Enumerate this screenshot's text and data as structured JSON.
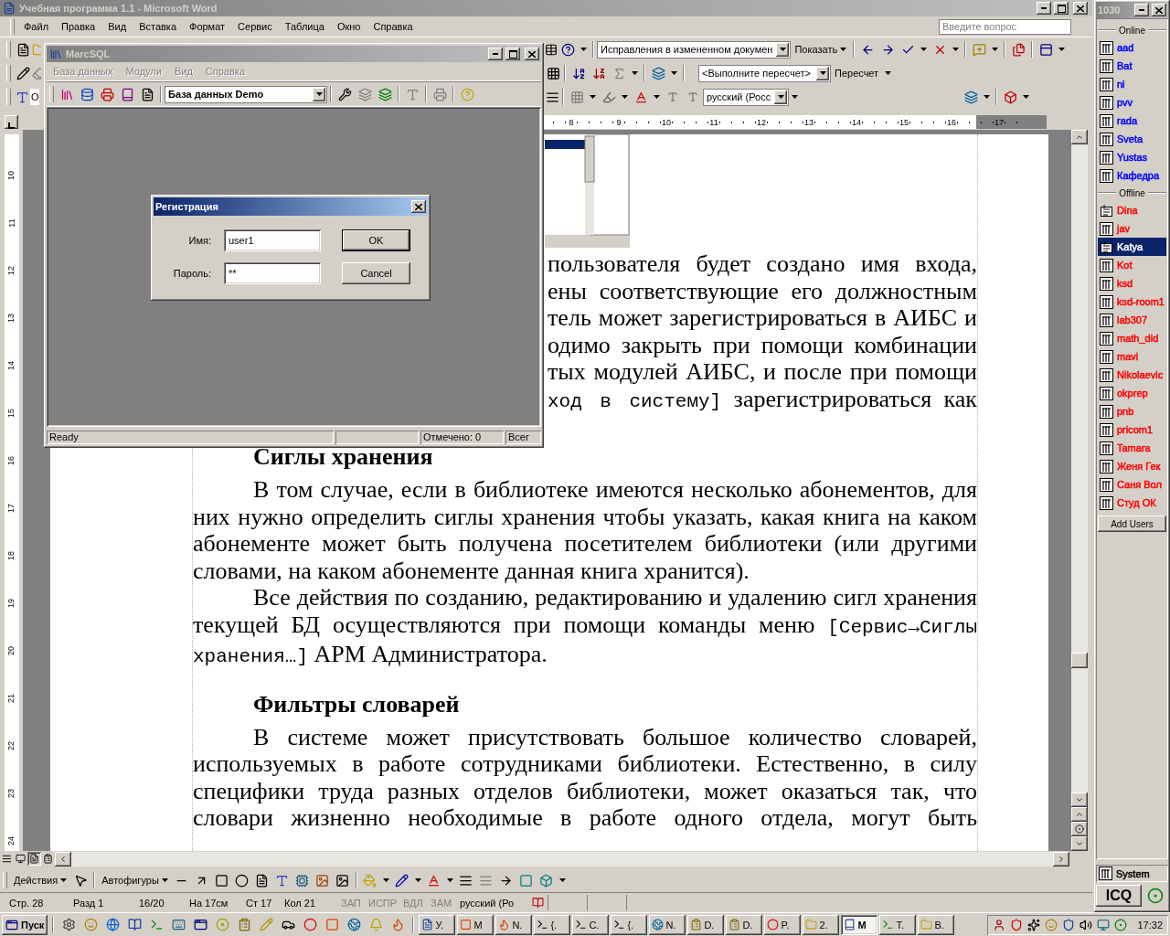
{
  "word": {
    "title": "Учебная программа 1.1 - Microsoft Word",
    "menu": [
      "Файл",
      "Правка",
      "Вид",
      "Вставка",
      "Формат",
      "Сервис",
      "Таблица",
      "Окно",
      "Справка"
    ],
    "question_box": {
      "placeholder": "Введите вопрос"
    },
    "toolbar": {
      "style_box": "О",
      "reviewing_combo": "Исправления в измененном докумен",
      "show_button": "Показать",
      "formula_combo": "<Выполните пересчет>",
      "recalc_button": "Пересчет",
      "language_combo": "русский (Росс"
    },
    "ruler": [
      "8",
      "9",
      "10",
      "11",
      "12",
      "13",
      "14",
      "15",
      "16",
      "17"
    ],
    "vertical_ruler": [
      "10",
      "11",
      "12",
      "13",
      "14",
      "15",
      "16",
      "17",
      "18",
      "19",
      "20",
      "21",
      "22",
      "23",
      "24"
    ],
    "document": {
      "partial_lines": [
        [
          {
            "kind": "text",
            "text": "пользователя будет создано имя входа,"
          }
        ],
        [
          {
            "kind": "text",
            "text": "ены соответствующие его должностным"
          }
        ],
        [
          {
            "kind": "text",
            "text": "тель может зарегистрироваться в АИБС и"
          }
        ],
        [
          {
            "kind": "text",
            "text": "одимо закрыть при помощи комбинации"
          }
        ],
        [
          {
            "kind": "text",
            "text": "тых модулей АИБС, и после при помощи"
          }
        ],
        [
          {
            "kind": "code",
            "text": "ход в систему]"
          },
          {
            "kind": "text",
            "text": " зарегистрироваться как"
          }
        ]
      ],
      "blocks": [
        {
          "kind": "heading",
          "parts": [
            {
              "kind": "text",
              "text": "Сиглы хранения"
            }
          ]
        },
        {
          "kind": "paragraph",
          "parts": [
            {
              "kind": "text",
              "text": "В том случае, если в библиотеке имеются несколько абонементов, для них нужно определить сиглы хранения чтобы указать, какая книга на каком абонементе может быть получена посетителем библиотеки (или другими словами, на каком абонементе данная книга хранится)."
            }
          ]
        },
        {
          "kind": "paragraph",
          "parts": [
            {
              "kind": "text",
              "text": "Все действия по созданию, редактированию и удалению сигл хранения текущей БД осуществляются при помощи команды меню "
            },
            {
              "kind": "code",
              "text": "[Сервис→Сиглы хранения…]"
            },
            {
              "kind": "text",
              "text": " АРМ Администратора."
            }
          ]
        },
        {
          "kind": "heading",
          "parts": [
            {
              "kind": "text",
              "text": "Фильтры словарей"
            }
          ]
        },
        {
          "kind": "paragraph",
          "parts": [
            {
              "kind": "text",
              "text": "В системе может присутствовать большое количество словарей, используемых в работе сотрудниками библиотеки. Естественно, в силу специфики труда разных отделов библиотеки, может оказаться так, что словари жизненно необходимые в работе одного отдела, могут быть"
            }
          ]
        }
      ]
    },
    "drawing_toolbar": {
      "actions": "Действия",
      "autoshapes": "Автофигуры"
    },
    "status_bar": {
      "fields": [
        "Стр. 28",
        "Разд 1",
        "16/20",
        "На 17см",
        "Ст 17",
        "Кол 21"
      ],
      "modes": [
        {
          "label": "ЗАП",
          "on": false
        },
        {
          "label": "ИСПР",
          "on": false
        },
        {
          "label": "ВДЛ",
          "on": false
        },
        {
          "label": "ЗАМ",
          "on": false
        }
      ],
      "language": "русский (Ро"
    }
  },
  "marcsql": {
    "title": "MarcSQL",
    "menu": [
      {
        "label": "База данных",
        "disabled": true
      },
      {
        "label": "Модули",
        "disabled": true
      },
      {
        "label": "Вид",
        "disabled": true
      },
      {
        "label": "Справка",
        "disabled": true
      }
    ],
    "database_combo": "База данных Demo",
    "status": {
      "message": "Ready",
      "marked": "Отмечено: 0",
      "total": "Всег"
    }
  },
  "dialog": {
    "title": "Регистрация",
    "fields": [
      {
        "label": "Имя:",
        "value": "user1"
      },
      {
        "label": "Пароль:",
        "value": "**"
      }
    ],
    "buttons": [
      {
        "label": "OK",
        "default": true
      },
      {
        "label": "Cancel",
        "default": false
      }
    ]
  },
  "icq": {
    "title": "1030",
    "groups": [
      {
        "label": "Online",
        "contacts": [
          {
            "name": "aad",
            "kind": "contact",
            "selected": false,
            "color": "#0000ff"
          },
          {
            "name": "Bat",
            "kind": "contact",
            "selected": false,
            "color": "#0000ff"
          },
          {
            "name": "ni",
            "kind": "contact",
            "selected": false,
            "color": "#0000ff"
          },
          {
            "name": "pvv",
            "kind": "contact",
            "selected": false,
            "color": "#0000ff"
          },
          {
            "name": "rada",
            "kind": "contact",
            "selected": false,
            "color": "#0000ff"
          },
          {
            "name": "Sveta",
            "kind": "contact",
            "selected": false,
            "color": "#0000ff"
          },
          {
            "name": "Yustas",
            "kind": "contact",
            "selected": false,
            "color": "#0000ff"
          },
          {
            "name": "Кафедра",
            "kind": "contact",
            "selected": false,
            "color": "#0000ff"
          }
        ]
      },
      {
        "label": "Offline",
        "contacts": [
          {
            "name": "Dina",
            "kind": "message",
            "selected": false,
            "color": "#ff0000"
          },
          {
            "name": "jav",
            "kind": "contact",
            "selected": false,
            "color": "#ff0000"
          },
          {
            "name": "Katya",
            "kind": "message",
            "selected": true
          },
          {
            "name": "Kot",
            "kind": "contact",
            "selected": false,
            "color": "#ff0000"
          },
          {
            "name": "ksd",
            "kind": "contact",
            "selected": false,
            "color": "#ff0000"
          },
          {
            "name": "ksd-room1",
            "kind": "contact",
            "selected": false,
            "color": "#ff0000"
          },
          {
            "name": "lab307",
            "kind": "contact",
            "selected": false,
            "color": "#ff0000"
          },
          {
            "name": "math_did",
            "kind": "contact",
            "selected": false,
            "color": "#ff0000"
          },
          {
            "name": "mavi",
            "kind": "contact",
            "selected": false,
            "color": "#ff0000"
          },
          {
            "name": "Nikolaevic",
            "kind": "contact",
            "selected": false,
            "color": "#ff0000"
          },
          {
            "name": "okprep",
            "kind": "contact",
            "selected": false,
            "color": "#ff0000"
          },
          {
            "name": "pnb",
            "kind": "contact",
            "selected": false,
            "color": "#ff0000"
          },
          {
            "name": "pricom1",
            "kind": "contact",
            "selected": false,
            "color": "#ff0000"
          },
          {
            "name": "Tamara",
            "kind": "contact",
            "selected": false,
            "color": "#ff0000"
          },
          {
            "name": "Женя Гек",
            "kind": "contact",
            "selected": false,
            "color": "#ff0000"
          },
          {
            "name": "Саня Вол",
            "kind": "contact",
            "selected": false,
            "color": "#ff0000"
          },
          {
            "name": "Студ ОК",
            "kind": "contact",
            "selected": false,
            "color": "#ff0000"
          }
        ]
      }
    ],
    "add_button": "Add Users",
    "system": "System",
    "logo": "ICQ"
  },
  "taskbar": {
    "start": "Пуск",
    "tasks": [
      {
        "label": "У.",
        "selected": false
      },
      {
        "label": "M",
        "selected": false
      },
      {
        "label": "N.",
        "selected": false
      },
      {
        "label": "{.",
        "selected": false
      },
      {
        "label": "C.",
        "selected": false
      },
      {
        "label": "{.",
        "selected": false
      },
      {
        "label": "N.",
        "selected": false
      },
      {
        "label": "D.",
        "selected": false
      },
      {
        "label": "D.",
        "selected": false
      },
      {
        "label": "P.",
        "selected": false
      },
      {
        "label": "2.",
        "selected": false
      },
      {
        "label": "M",
        "selected": true
      },
      {
        "label": "T.",
        "selected": false
      },
      {
        "label": "B.",
        "selected": false
      }
    ],
    "clock": "17:32"
  }
}
